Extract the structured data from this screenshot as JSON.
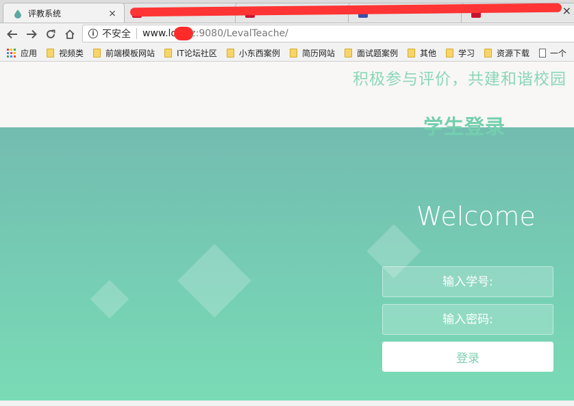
{
  "browser": {
    "tabs": [
      {
        "title": "评教系统",
        "close": "×"
      }
    ],
    "window_close": "×",
    "address": {
      "insecure_label": "不安全",
      "url_host": "www.ld",
      "url_host_tail": "z:9080",
      "url_path": "/LevalTeache/"
    },
    "bookmarks": [
      {
        "label": "应用",
        "icon": "apps-icon"
      },
      {
        "label": "视频类",
        "icon": "folder-icon"
      },
      {
        "label": "前端模板网站",
        "icon": "folder-icon"
      },
      {
        "label": "IT论坛社区",
        "icon": "folder-icon"
      },
      {
        "label": "小东西案例",
        "icon": "folder-icon"
      },
      {
        "label": "简历网站",
        "icon": "folder-icon"
      },
      {
        "label": "面试题案例",
        "icon": "folder-icon"
      },
      {
        "label": "其他",
        "icon": "folder-icon"
      },
      {
        "label": "学习",
        "icon": "folder-icon"
      },
      {
        "label": "资源下载",
        "icon": "folder-icon"
      },
      {
        "label": "一个",
        "icon": "page-icon"
      }
    ]
  },
  "page": {
    "slogan": "积极参与评价，共建和谐校园",
    "login_title": "学生登录",
    "welcome": "Welcome",
    "student_id_placeholder": "输入学号:",
    "password_placeholder": "输入密码:",
    "login_button": "登录"
  },
  "colors": {
    "accent": "#7ccfb0",
    "hero_top": "#73bcb0",
    "hero_bottom": "#7adbb6",
    "redaction": "#ff3434"
  }
}
